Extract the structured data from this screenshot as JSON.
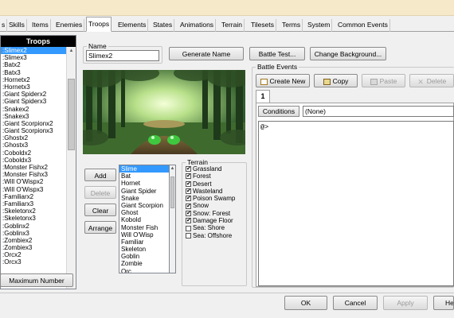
{
  "tabs": [
    {
      "label": "s"
    },
    {
      "label": "Skills"
    },
    {
      "label": "Items"
    },
    {
      "label": "Enemies"
    },
    {
      "label": "Troops"
    },
    {
      "label": "Elements"
    },
    {
      "label": "States"
    },
    {
      "label": "Animations"
    },
    {
      "label": "Terrain"
    },
    {
      "label": "Tilesets"
    },
    {
      "label": "Terms"
    },
    {
      "label": "System"
    },
    {
      "label": "Common Events"
    }
  ],
  "troops_panel": {
    "title": "Troops",
    "items": [
      ":Slimex2",
      ":Slimex3",
      ":Batx2",
      ":Batx3",
      ":Hornetx2",
      ":Hornetx3",
      ":Giant Spiderx2",
      ":Giant Spiderx3",
      ":Snakex2",
      ":Snakex3",
      ":Giant Scorpionx2",
      ":Giant Scorpionx3",
      ":Ghostx2",
      ":Ghostx3",
      ":Coboldx2",
      ":Coboldx3",
      ":Monster Fishx2",
      ":Monster Fishx3",
      ":Will O'Wispx2",
      ":Will O'Wispx3",
      ":Familiarx2",
      ":Familiarx3",
      ":Skeletonx2",
      ":Skeletonx3",
      ":Goblinx2",
      ":Goblinx3",
      ":Zombiex2",
      ":Zombiex3",
      ":Orcx2",
      ":Orcx3"
    ],
    "max_button": "Maximum Number"
  },
  "name_group": {
    "label": "Name",
    "value": "Slimex2"
  },
  "buttons": {
    "generate_name": "Generate Name",
    "battle_test": "Battle Test...",
    "change_background": "Change Background..."
  },
  "enemy_buttons": {
    "add": "Add",
    "delete": "Delete",
    "clear": "Clear",
    "arrange": "Arrange"
  },
  "enemies": [
    "Slime",
    "Bat",
    "Hornet",
    "Giant Spider",
    "Snake",
    "Giant Scorpion",
    "Ghost",
    "Kobold",
    "Monster Fish",
    "Will O'Wisp",
    "Familiar",
    "Skeleton",
    "Goblin",
    "Zombie",
    "Orc"
  ],
  "terrain": {
    "label": "Terrain",
    "items": [
      {
        "label": "Grassland",
        "checked": true
      },
      {
        "label": "Forest",
        "checked": true
      },
      {
        "label": "Desert",
        "checked": true
      },
      {
        "label": "Wasteland",
        "checked": true
      },
      {
        "label": "Poison Swamp",
        "checked": true
      },
      {
        "label": "Snow",
        "checked": true
      },
      {
        "label": "Snow: Forest",
        "checked": true
      },
      {
        "label": "Damage Floor",
        "checked": true
      },
      {
        "label": "Sea: Shore",
        "checked": false
      },
      {
        "label": "Sea: Offshore",
        "checked": false
      }
    ]
  },
  "battle_events": {
    "label": "Battle Events",
    "create_new": "Create New",
    "copy": "Copy",
    "paste": "Paste",
    "delete": "Delete",
    "page_tab": "1",
    "conditions_label": "Conditions",
    "conditions_value": "(None)",
    "event_line": "@>"
  },
  "dialog_buttons": {
    "ok": "OK",
    "cancel": "Cancel",
    "apply": "Apply",
    "help": "He"
  },
  "colors": {
    "accent": "#3399ff",
    "title_bar": "#f5e9c9"
  }
}
